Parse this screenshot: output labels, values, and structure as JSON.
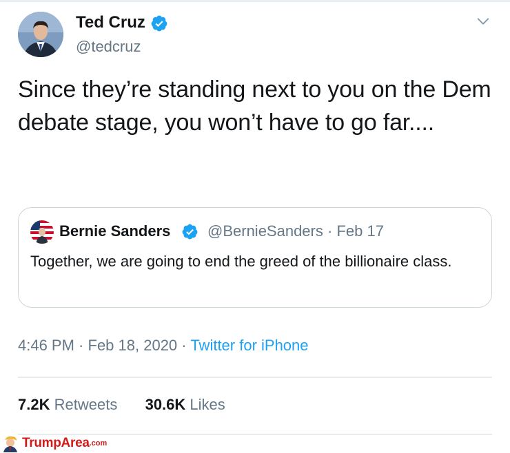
{
  "tweet": {
    "author": {
      "name": "Ted Cruz",
      "handle": "@tedcruz",
      "verified": true
    },
    "text": "Since they’re standing next to you on the Dem debate stage, you won’t have to go far....",
    "quoted": {
      "name": "Bernie Sanders",
      "handle": "@BernieSanders",
      "date": "Feb 17",
      "verified": true,
      "text": "Together, we are going to end the greed of the billionaire class."
    },
    "time": "4:46 PM",
    "date": "Feb 18, 2020",
    "source": "Twitter for iPhone",
    "stats": {
      "retweets": "7.2K",
      "retweets_label": "Retweets",
      "likes": "30.6K",
      "likes_label": "Likes"
    }
  },
  "watermark": {
    "brand": "TrumpArea",
    "domain": ".com"
  },
  "icons": {
    "verified": "verified-badge-icon",
    "menu": "chevron-down-icon"
  },
  "colors": {
    "link": "#1da1f2",
    "muted": "#657786",
    "border": "#ccd6dd",
    "watermark": "#d31b1b"
  }
}
